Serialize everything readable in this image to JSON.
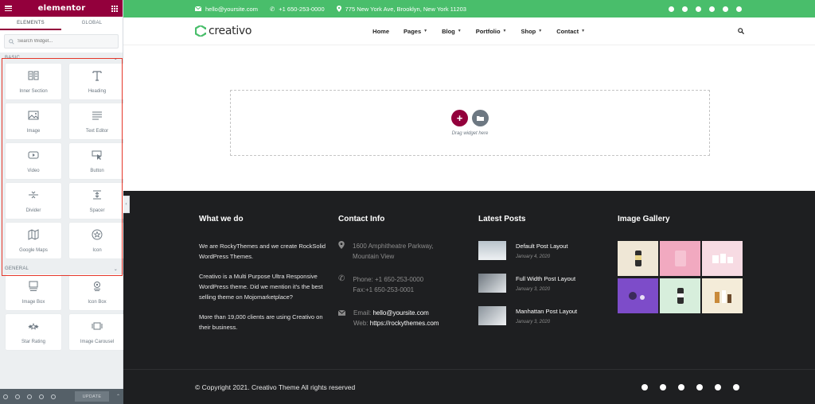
{
  "panel": {
    "brand": "elementor",
    "tabs": [
      "ELEMENTS",
      "GLOBAL"
    ],
    "search_placeholder": "Search Widget...",
    "basic_section": "BASIC",
    "basic_widgets": [
      {
        "label": "Inner Section",
        "icon": "columns-icon"
      },
      {
        "label": "Heading",
        "icon": "heading-icon"
      },
      {
        "label": "Image",
        "icon": "image-icon"
      },
      {
        "label": "Text Editor",
        "icon": "text-editor-icon"
      },
      {
        "label": "Video",
        "icon": "video-icon"
      },
      {
        "label": "Button",
        "icon": "button-icon"
      },
      {
        "label": "Divider",
        "icon": "divider-icon"
      },
      {
        "label": "Spacer",
        "icon": "spacer-icon"
      },
      {
        "label": "Google Maps",
        "icon": "map-icon"
      },
      {
        "label": "Icon",
        "icon": "star-icon"
      }
    ],
    "general_section": "GENERAL",
    "general_widgets": [
      {
        "label": "Image Box",
        "icon": "image-box-icon"
      },
      {
        "label": "Icon Box",
        "icon": "icon-box-icon"
      },
      {
        "label": "Star Rating",
        "icon": "star-rating-icon"
      },
      {
        "label": "Image Carousel",
        "icon": "carousel-icon"
      }
    ],
    "update_label": "UPDATE",
    "accent_color": "#93003c"
  },
  "topbar": {
    "email": "hello@yoursite.com",
    "phone": "+1 650-253-0000",
    "address": "775 New York Ave, Brooklyn, New York 11203",
    "color": "#49be6b"
  },
  "nav": {
    "logo": "creativo",
    "items": [
      "Home",
      "Pages",
      "Blog",
      "Portfolio",
      "Shop",
      "Contact"
    ]
  },
  "dropzone": {
    "hint": "Drag widget here"
  },
  "footer": {
    "what_we_do": {
      "title": "What we do",
      "p1": "We are RockyThemes and we create RockSolid WordPress Themes.",
      "p2": "Creativo is a Multi Purpose Ultra Responsive WordPress theme. Did we mention it's the best selling theme on Mojomarketplace?",
      "p3": "More than 19,000 clients are using Creativo on their business."
    },
    "contact": {
      "title": "Contact Info",
      "address_line1": "1600 Amphitheatre Parkway,",
      "address_line2": "Mountain View",
      "phone_line": "Phone: +1 650-253-0000",
      "fax_line": "Fax:+1 650-253-0001",
      "email_label": "Email: ",
      "email_value": "hello@yoursite.com",
      "web_label": "Web: ",
      "web_value": "https://rockythemes.com"
    },
    "posts": {
      "title": "Latest Posts",
      "items": [
        {
          "title": "Default Post Layout",
          "date": "January 4, 2020"
        },
        {
          "title": "Full Width Post Layout",
          "date": "January 3, 2020"
        },
        {
          "title": "Manhattan Post Layout",
          "date": "January 3, 2020"
        }
      ]
    },
    "gallery": {
      "title": "Image Gallery"
    },
    "copyright": "© Copyright 2021. Creativo Theme All rights reserved"
  }
}
